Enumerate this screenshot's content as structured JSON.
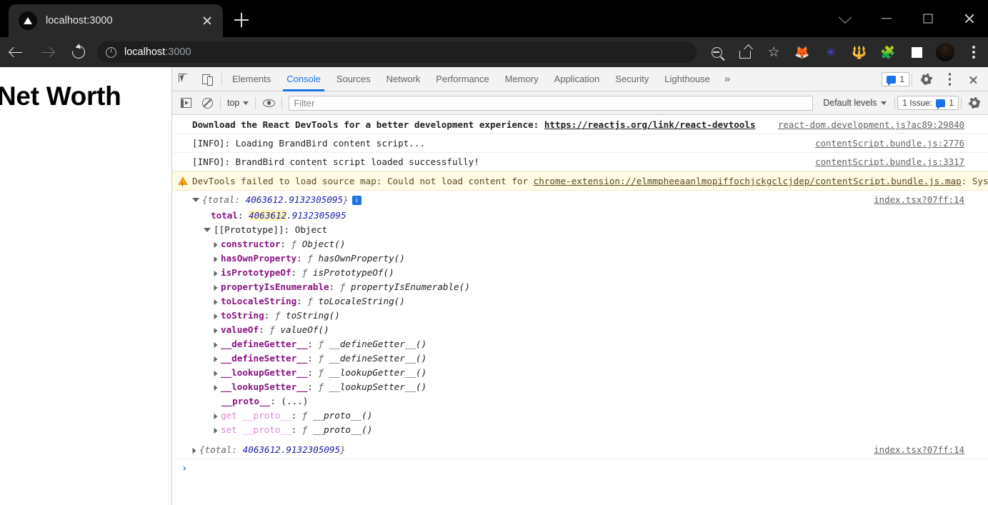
{
  "browser": {
    "tab": {
      "title": "localhost:3000",
      "favicon": "nextjs-triangle-icon",
      "close_icon": "close-icon"
    },
    "new_tab_icon": "plus-icon",
    "window_controls": [
      "chevron-down-icon",
      "minimize-icon",
      "maximize-icon",
      "close-icon"
    ],
    "nav": {
      "back_icon": "back-arrow-icon",
      "forward_icon": "forward-arrow-icon",
      "reload_icon": "reload-icon"
    },
    "omnibox": {
      "info_icon": "page-info-icon",
      "host": "localhost",
      "port": ":3000"
    },
    "toolbar_icons": [
      {
        "name": "zoom-out-icon"
      },
      {
        "name": "share-icon"
      },
      {
        "name": "bookmark-star-icon"
      },
      {
        "name": "metamask-extension-icon",
        "glyph": "🦊"
      },
      {
        "name": "extension-blue-icon",
        "glyph": "✳"
      },
      {
        "name": "brandbird-extension-icon",
        "glyph": "🔱"
      },
      {
        "name": "extensions-puzzle-icon",
        "glyph": "🧩"
      },
      {
        "name": "side-panel-icon"
      },
      {
        "name": "profile-avatar"
      },
      {
        "name": "browser-menu-icon"
      }
    ]
  },
  "page": {
    "heading": "Net Worth"
  },
  "devtools": {
    "tools": {
      "inspect_icon": "inspect-element-icon",
      "device_icon": "device-toolbar-icon"
    },
    "tabs": [
      {
        "label": "Elements",
        "active": false
      },
      {
        "label": "Console",
        "active": true
      },
      {
        "label": "Sources",
        "active": false
      },
      {
        "label": "Network",
        "active": false
      },
      {
        "label": "Performance",
        "active": false
      },
      {
        "label": "Memory",
        "active": false
      },
      {
        "label": "Application",
        "active": false
      },
      {
        "label": "Security",
        "active": false
      },
      {
        "label": "Lighthouse",
        "active": false
      }
    ],
    "more_tabs": "»",
    "message_count": "1",
    "settings_icon": "settings-gear-icon",
    "menu_icon": "devtools-menu-icon",
    "close_icon": "devtools-close-icon",
    "console_toolbar": {
      "sidebar_icon": "console-sidebar-icon",
      "clear_icon": "clear-console-icon",
      "context": "top",
      "eye_icon": "live-expression-icon",
      "filter_placeholder": "Filter",
      "levels": "Default levels",
      "issues_label": "1 Issue:",
      "issues_count": "1",
      "console_settings_icon": "console-settings-icon"
    }
  },
  "console_log": [
    {
      "id": "react-devtools",
      "text_before": "Download the React DevTools for a better development experience: ",
      "link": "https://reactjs.org/link/react-devtools",
      "source": "react-dom.development.js?ac89:29840"
    },
    {
      "id": "loading-brandbird",
      "text": "[INFO]: Loading BrandBird content script...",
      "source": "contentScript.bundle.js:2776"
    },
    {
      "id": "brandbird-loaded",
      "text": "[INFO]: BrandBird content script loaded successfully!",
      "source": "contentScript.bundle.js:3317"
    },
    {
      "id": "source-map-warning",
      "level": "warning",
      "text_before": "DevTools failed to load source map: Could not load content for ",
      "link": "chrome-extension://elmmpheeaanlmopiffochjckgclcjdep/contentScript.bundle.js.map",
      "text_after": ": System error: net::ERR_BLOCKED_BY_CLIENT"
    }
  ],
  "object_expanded": {
    "source": "index.tsx?07ff:14",
    "preview_prefix": "{total: ",
    "preview_value": "4063612.9132305095",
    "preview_suffix": "}",
    "info_badge": "i",
    "total_key": "total",
    "total_highlight": "4063612",
    "total_rest": ".9132305095",
    "prototype_label": "[[Prototype]]: Object",
    "properties": [
      {
        "name": "constructor",
        "value": "Object()"
      },
      {
        "name": "hasOwnProperty",
        "value": "hasOwnProperty()"
      },
      {
        "name": "isPrototypeOf",
        "value": "isPrototypeOf()"
      },
      {
        "name": "propertyIsEnumerable",
        "value": "propertyIsEnumerable()"
      },
      {
        "name": "toLocaleString",
        "value": "toLocaleString()"
      },
      {
        "name": "toString",
        "value": "toString()"
      },
      {
        "name": "valueOf",
        "value": "valueOf()"
      },
      {
        "name": "__defineGetter__",
        "value": "__defineGetter__()"
      },
      {
        "name": "__defineSetter__",
        "value": "__defineSetter__()"
      },
      {
        "name": "__lookupGetter__",
        "value": "__lookupGetter__()"
      },
      {
        "name": "__lookupSetter__",
        "value": "__lookupSetter__()"
      }
    ],
    "proto_dots_key": "__proto__",
    "proto_dots_value": "(...)",
    "accessors": [
      {
        "kw": "get",
        "name": "__proto__",
        "value": "__proto__()"
      },
      {
        "kw": "set",
        "name": "__proto__",
        "value": "__proto__()"
      }
    ]
  },
  "object_collapsed": {
    "preview_prefix": "{total: ",
    "preview_value": "4063612.9132305095",
    "preview_suffix": "}",
    "source": "index.tsx?07ff:14"
  },
  "prompt": {
    "caret": "›"
  },
  "colors": {
    "accent": "#1a73e8",
    "warning_bg": "#fffbe5",
    "warning_icon": "#f29d12",
    "highlight": "#fff8b8",
    "property_name": "#881280",
    "number": "#1a1aa6"
  }
}
